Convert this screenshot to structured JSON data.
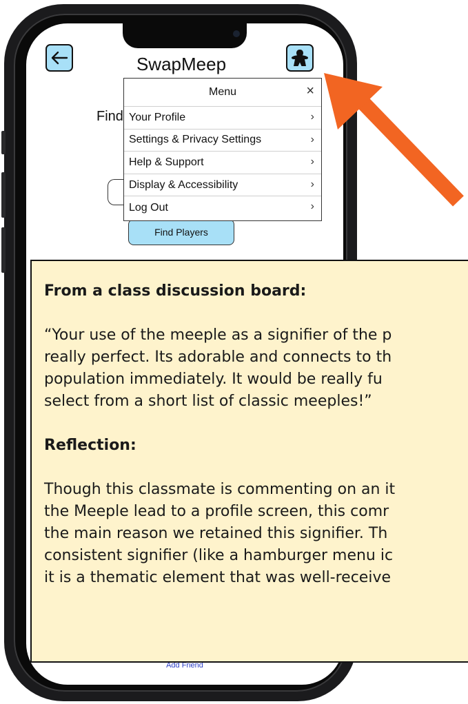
{
  "app": {
    "title": "SwapMeep"
  },
  "header": {
    "back_icon": "arrow-left-icon",
    "profile_icon": "meeple-icon",
    "accent_color": "#a8e0f7"
  },
  "screen": {
    "find_text": "Find",
    "find_players_label": "Find Players",
    "add_friend_label": "Add Friend"
  },
  "menu": {
    "title": "Menu",
    "close_icon": "close-icon",
    "items": [
      {
        "label": "Your Profile"
      },
      {
        "label": "Settings & Privacy Settings"
      },
      {
        "label": "Help & Support"
      },
      {
        "label": "Display & Accessibility"
      },
      {
        "label": "Log Out"
      }
    ]
  },
  "annotation": {
    "arrow_color": "#f26522",
    "box_color": "#fef3cc",
    "heading1": "From a class discussion board:",
    "quote": "“Your use of the meeple as a signifier of the p\nreally perfect. Its adorable and connects to th\npopulation immediately. It would be really fu\nselect from a short list of classic meeples!”",
    "heading2": "Reflection:",
    "reflection": "Though this classmate is commenting on an it\nthe Meeple lead to a profile screen, this comr\nthe main reason we retained this signifier. Th\nconsistent signifier (like a hamburger menu ic\nit is a thematic element that was well-receive"
  }
}
